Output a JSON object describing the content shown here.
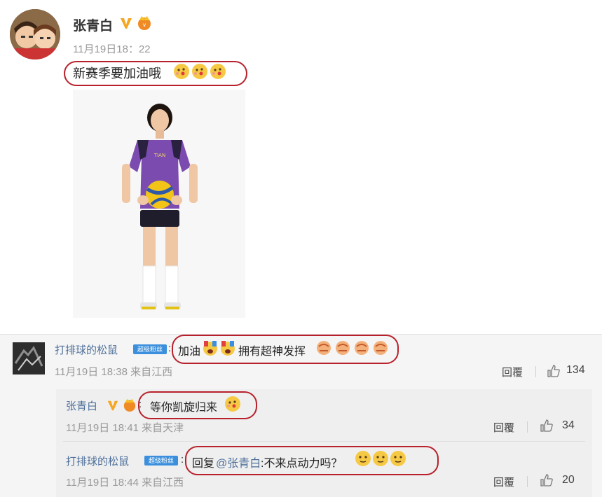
{
  "post": {
    "author": "张青白",
    "time": "11月19日18：22",
    "text": "新赛季要加油哦",
    "emojis": [
      "kiss-emoji",
      "kiss-emoji",
      "kiss-emoji"
    ]
  },
  "comments": [
    {
      "name": "打排球的松鼠",
      "badge": "超级粉丝",
      "text_prefix": "加油",
      "text_suffix": "拥有超神发挥",
      "time": "11月19日  18:38  来自江西",
      "reply_label": "回覆",
      "likes": "134"
    }
  ],
  "replies": [
    {
      "name": "张青白",
      "text": "等你凯旋归来",
      "time": "11月19日  18:41  来自天津",
      "reply_label": "回覆",
      "likes": "34"
    },
    {
      "name": "打排球的松鼠",
      "badge": "超级粉丝",
      "reply_prefix": "回复",
      "mention": "@张青白",
      "text": ":不来点动力吗？",
      "time": "11月19日  18:44  来自江西",
      "reply_label": "回覆",
      "likes": "20"
    }
  ],
  "colors": {
    "accent_red": "#b8202b",
    "link_blue": "#4d6f9a",
    "verified_gold": "#f5a623"
  }
}
